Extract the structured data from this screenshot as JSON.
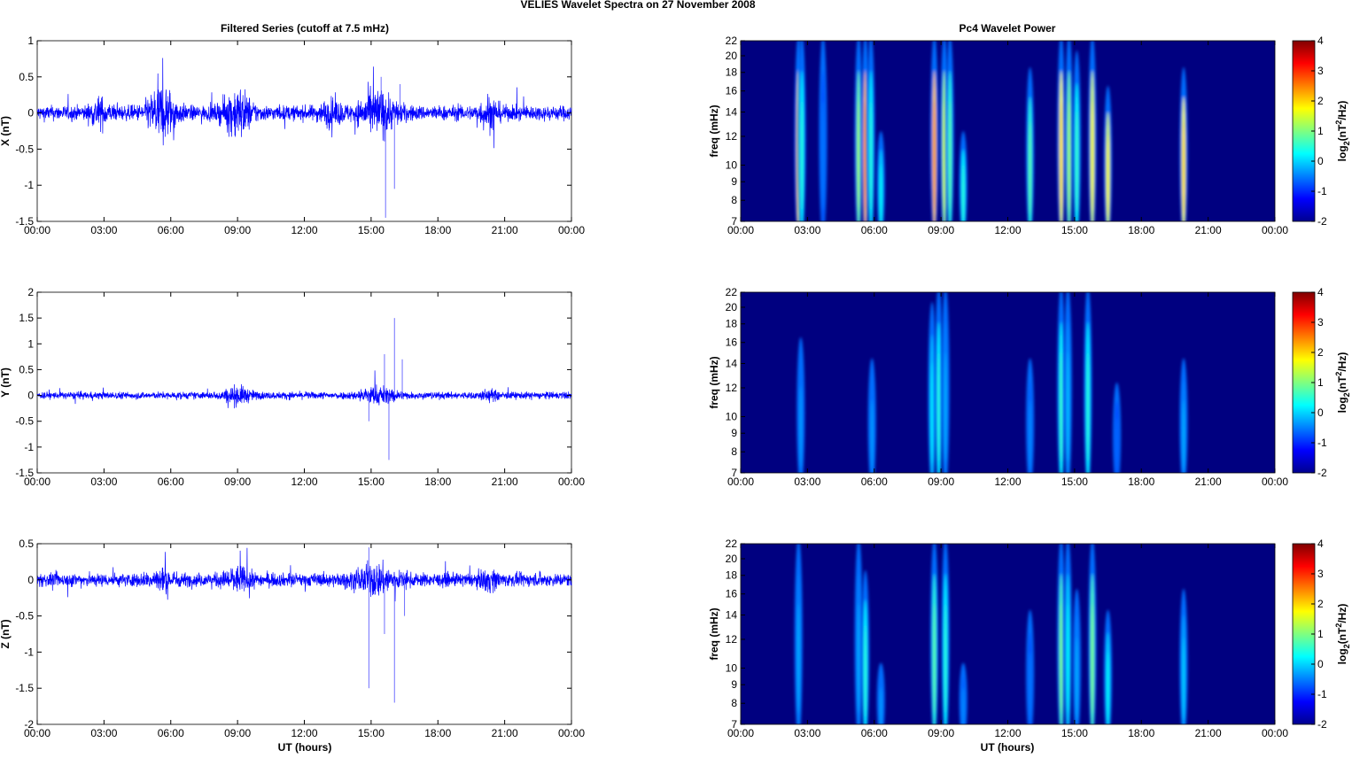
{
  "title": "VELIES Wavelet Spectra on 27 November  2008",
  "chart_data": {
    "type": "line",
    "left_title": "Filtered Series (cutoff at 7.5 mHz)",
    "right_title": "Pc4 Wavelet Power",
    "xlabel": "UT (hours)",
    "x_range_hours": [
      0,
      24
    ],
    "x_ticks": [
      "00:00",
      "03:00",
      "06:00",
      "09:00",
      "12:00",
      "15:00",
      "18:00",
      "21:00",
      "00:00"
    ],
    "series_color": "#0000ff",
    "time_series": [
      {
        "name": "X",
        "ylabel": "X (nT)",
        "ylim": [
          -1.5,
          1
        ],
        "yticks": [
          1,
          0.5,
          0,
          -0.5,
          -1,
          -1.5
        ],
        "base_amplitude": 0.09,
        "bursts": [
          [
            2.8,
            0.12,
            0.4
          ],
          [
            5.6,
            0.3,
            0.6
          ],
          [
            9.0,
            0.25,
            0.6
          ],
          [
            13.2,
            0.1,
            0.5
          ],
          [
            15.3,
            0.22,
            0.8
          ],
          [
            20.3,
            0.15,
            0.4
          ]
        ],
        "spikes": [
          [
            15.65,
            -1.45
          ],
          [
            16.05,
            -1.05
          ],
          [
            15.45,
            0.5
          ],
          [
            16.3,
            0.4
          ]
        ]
      },
      {
        "name": "Y",
        "ylabel": "Y (nT)",
        "ylim": [
          -1.5,
          2
        ],
        "yticks": [
          2,
          1.5,
          1,
          0.5,
          0,
          -0.5,
          -1,
          -1.5
        ],
        "base_amplitude": 0.06,
        "bursts": [
          [
            9.0,
            0.12,
            0.6
          ],
          [
            15.3,
            0.12,
            0.8
          ],
          [
            20.3,
            0.06,
            0.4
          ]
        ],
        "spikes": [
          [
            15.8,
            -1.25
          ],
          [
            16.05,
            1.5
          ],
          [
            15.6,
            0.8
          ],
          [
            16.4,
            0.7
          ],
          [
            14.9,
            -0.5
          ]
        ]
      },
      {
        "name": "Z",
        "ylabel": "Z (nT)",
        "ylim": [
          -2,
          0.5
        ],
        "yticks": [
          0.5,
          0,
          -0.5,
          -1,
          -1.5,
          -2
        ],
        "base_amplitude": 0.08,
        "bursts": [
          [
            5.6,
            0.08,
            0.6
          ],
          [
            9.0,
            0.1,
            0.6
          ],
          [
            15.2,
            0.14,
            0.9
          ],
          [
            20.3,
            0.08,
            0.4
          ]
        ],
        "spikes": [
          [
            14.9,
            -1.5
          ],
          [
            15.6,
            -0.75
          ],
          [
            16.05,
            -1.7
          ],
          [
            16.5,
            -0.5
          ],
          [
            14.9,
            0.45
          ]
        ]
      }
    ],
    "spectrograms": [
      {
        "name": "X",
        "ylabel": "freq (mHz)",
        "colorbar_label": "log2(nT2/Hz)",
        "streaks": [
          [
            2.6,
            2.2,
            22
          ],
          [
            2.75,
            0.5,
            22
          ],
          [
            3.7,
            -0.5,
            22
          ],
          [
            5.3,
            1.2,
            22
          ],
          [
            5.6,
            2.5,
            22
          ],
          [
            5.85,
            0.5,
            22
          ],
          [
            6.3,
            0.3,
            12
          ],
          [
            8.7,
            2.4,
            22
          ],
          [
            9.15,
            1.5,
            22
          ],
          [
            9.4,
            0.8,
            22
          ],
          [
            10.0,
            0.5,
            12
          ],
          [
            13.0,
            0.8,
            18
          ],
          [
            14.4,
            2.0,
            22
          ],
          [
            14.75,
            1.2,
            22
          ],
          [
            15.1,
            0.6,
            20
          ],
          [
            15.8,
            1.8,
            22
          ],
          [
            16.5,
            1.8,
            16
          ],
          [
            19.9,
            2.0,
            18
          ]
        ]
      },
      {
        "name": "Y",
        "ylabel": "freq (mHz)",
        "colorbar_label": "log2(nT2/Hz)",
        "streaks": [
          [
            2.7,
            -0.3,
            16
          ],
          [
            5.9,
            -0.3,
            14
          ],
          [
            8.6,
            0.2,
            20
          ],
          [
            8.9,
            0.5,
            22
          ],
          [
            9.2,
            -0.2,
            22
          ],
          [
            13.0,
            -0.4,
            14
          ],
          [
            14.4,
            0.6,
            22
          ],
          [
            14.7,
            -0.1,
            22
          ],
          [
            15.6,
            0.5,
            22
          ],
          [
            16.9,
            -0.6,
            12
          ],
          [
            19.9,
            -0.2,
            14
          ]
        ]
      },
      {
        "name": "Z",
        "ylabel": "freq (mHz)",
        "colorbar_label": "log2(nT2/Hz)",
        "streaks": [
          [
            2.6,
            -0.2,
            22
          ],
          [
            5.3,
            -0.2,
            22
          ],
          [
            5.6,
            0.5,
            18
          ],
          [
            6.3,
            -0.3,
            10
          ],
          [
            8.7,
            0.8,
            22
          ],
          [
            9.2,
            0.5,
            22
          ],
          [
            10.0,
            -0.4,
            10
          ],
          [
            13.0,
            -0.5,
            14
          ],
          [
            14.4,
            1.0,
            22
          ],
          [
            14.7,
            0.3,
            22
          ],
          [
            15.1,
            -0.2,
            16
          ],
          [
            15.8,
            1.0,
            22
          ],
          [
            16.5,
            0.3,
            14
          ],
          [
            19.9,
            0.0,
            16
          ]
        ]
      }
    ],
    "freq_ticks": [
      7,
      8,
      9,
      10,
      12,
      14,
      16,
      18,
      20,
      22
    ],
    "freq_range_mhz": [
      7,
      22
    ],
    "colorbar_ticks": [
      4,
      3,
      2,
      1,
      0,
      -1,
      -2
    ],
    "colorbar_range": [
      -2,
      4
    ]
  }
}
